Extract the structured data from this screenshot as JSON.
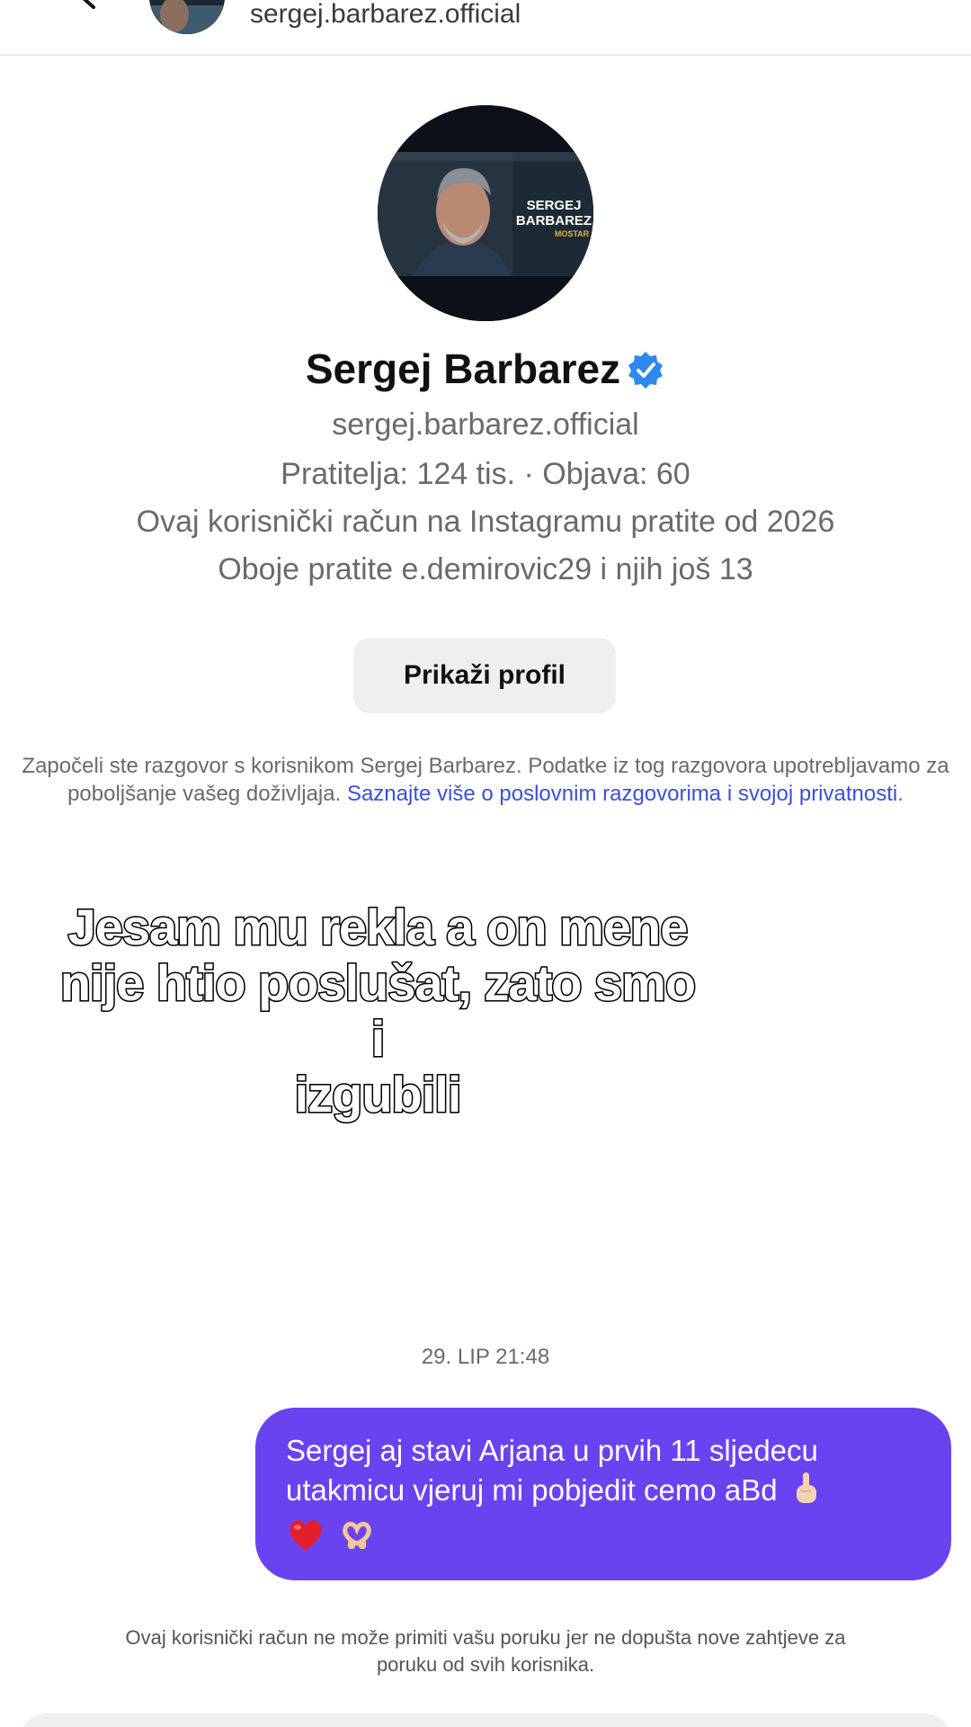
{
  "header": {
    "username": "sergej.barbarez.official"
  },
  "profile": {
    "name": "Sergej Barbarez",
    "username": "sergej.barbarez.official",
    "stats": "Pratitelja: 124 tis. · Objava: 60",
    "following_since": "Ovaj korisnički račun na Instagramu pratite od 2026",
    "mutuals": "Oboje pratite e.demirovic29 i njih još 13",
    "view_profile_label": "Prikaži profil",
    "avatar_text": {
      "line1": "SERGEJ",
      "line2": "BARBAREZ",
      "line3": "MOSTAR"
    }
  },
  "disclaimer": {
    "text": "Započeli ste razgovor s korisnikom Sergej Barbarez. Podatke iz tog razgovora upotrebljavamo za poboljšanje vašeg doživljaja. ",
    "link": "Saznajte više o poslovnim razgovorima i svojoj privatnosti",
    "end": "."
  },
  "overlay": {
    "line1": "Jesam mu rekla a on mene",
    "line2": "nije htio poslušat, zato smo i",
    "line3": "izgubili"
  },
  "chat": {
    "timestamp": "29. LIP 21:48",
    "message": "Sergej aj stavi Arjana u prvih 11 sljedecu utakmicu vjeruj mi pobjedit cemo aBd"
  },
  "footer_note": "Ovaj korisnički račun ne može primiti vašu poruku jer ne dopušta nove zahtjeve za poruku od svih korisnika.",
  "colors": {
    "bubble": "#6a43f0",
    "verified": "#2d88f0",
    "link": "#3b4fd8"
  }
}
